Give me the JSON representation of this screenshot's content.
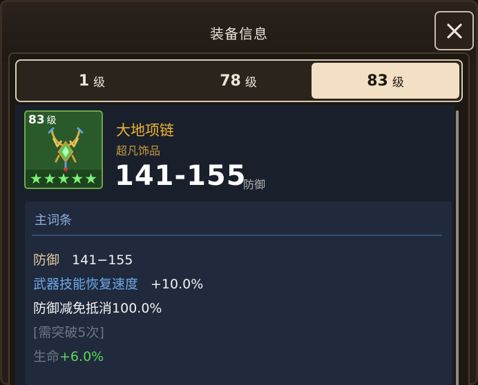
{
  "window": {
    "title": "装备信息",
    "close_icon": "close-icon"
  },
  "tabs": [
    {
      "level": "1",
      "unit": "级",
      "active": false
    },
    {
      "level": "78",
      "unit": "级",
      "active": false
    },
    {
      "level": "83",
      "unit": "级",
      "active": true
    }
  ],
  "item": {
    "level": "83",
    "level_unit": "级",
    "icon": "necklace-icon",
    "stars": 5,
    "name": "大地项链",
    "type": "超凡饰品",
    "main_value": "141-155",
    "main_stat": "防御"
  },
  "attributes": {
    "header": "主词条",
    "rows": [
      {
        "label": "防御",
        "value": "141−155"
      },
      {
        "label": "武器技能恢复速度",
        "value": "+10.0%"
      },
      {
        "label": "防御减免抵消",
        "value": "100.0%"
      },
      {
        "label": "[需突破5次]"
      },
      {
        "label": "生命",
        "value": "+6.0%"
      }
    ]
  },
  "colors": {
    "name": "#f0b430",
    "type": "#c89b3c",
    "blue_attr": "#6ea8e8",
    "green_value": "#5ad85a",
    "locked": "#6e7684"
  }
}
